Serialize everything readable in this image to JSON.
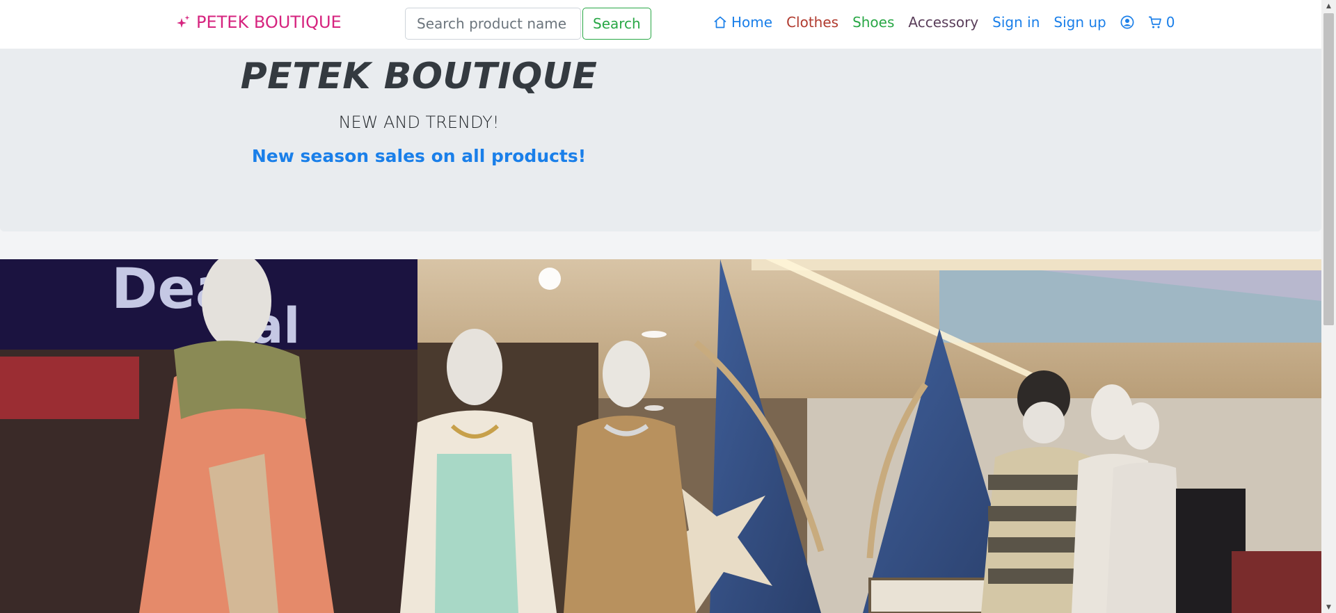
{
  "brand": {
    "name": "PETEK BOUTIQUE",
    "color": "#d6247f",
    "icon": "sparkles-icon"
  },
  "search": {
    "placeholder": "Search product name",
    "value": "",
    "button_label": "Search"
  },
  "nav": {
    "home": {
      "label": "Home",
      "icon": "house-icon",
      "color": "#1a7fe9"
    },
    "clothes": {
      "label": "Clothes",
      "color": "#b03a2e"
    },
    "shoes": {
      "label": "Shoes",
      "color": "#28a745"
    },
    "accessory": {
      "label": "Accessory",
      "color": "#5a3e5a"
    },
    "sign_in": {
      "label": "Sign in",
      "color": "#1a7fe9"
    },
    "sign_up": {
      "label": "Sign up",
      "color": "#1a7fe9"
    },
    "account": {
      "icon": "user-circle-icon"
    },
    "cart": {
      "icon": "cart-icon",
      "count": "0"
    }
  },
  "hero": {
    "title": "PETEK BOUTIQUE",
    "subtitle": "NEW AND TRENDY!",
    "promo": "New season sales on all products!"
  },
  "banner": {
    "description_icon": "store-mannequins-photo"
  }
}
